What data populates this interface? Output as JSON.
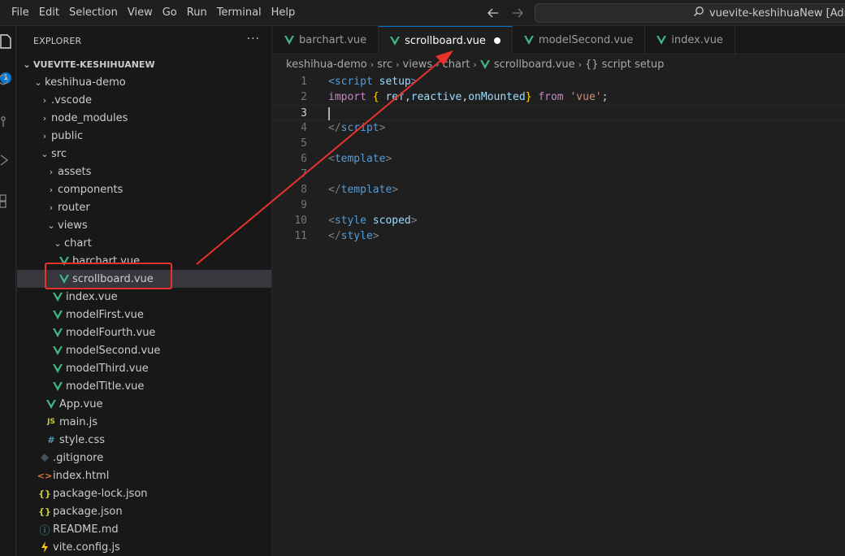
{
  "menu": {
    "items": [
      "File",
      "Edit",
      "Selection",
      "View",
      "Go",
      "Run",
      "Terminal",
      "Help"
    ]
  },
  "command_center": {
    "text": "vuevite-keshihuaNew [Administ",
    "icon": "search-icon"
  },
  "activity_bar": {
    "badge": "1",
    "icons": [
      "files-icon",
      "search-icon",
      "source-control-icon",
      "run-debug-icon",
      "extensions-icon"
    ]
  },
  "sidebar": {
    "title": "EXPLORER",
    "more": "···",
    "root": "VUEVITE-KESHIHUANEW",
    "items": [
      {
        "label": "keshihua-demo",
        "type": "folder-open"
      },
      {
        "label": ".vscode",
        "type": "folder"
      },
      {
        "label": "node_modules",
        "type": "folder"
      },
      {
        "label": "public",
        "type": "folder"
      },
      {
        "label": "src",
        "type": "folder-open"
      },
      {
        "label": "assets",
        "type": "folder"
      },
      {
        "label": "components",
        "type": "folder"
      },
      {
        "label": "router",
        "type": "folder"
      },
      {
        "label": "views",
        "type": "folder-open"
      },
      {
        "label": "chart",
        "type": "folder-open"
      },
      {
        "label": "barchart.vue",
        "type": "vue"
      },
      {
        "label": "scrollboard.vue",
        "type": "vue"
      },
      {
        "label": "index.vue",
        "type": "vue"
      },
      {
        "label": "modelFirst.vue",
        "type": "vue"
      },
      {
        "label": "modelFourth.vue",
        "type": "vue"
      },
      {
        "label": "modelSecond.vue",
        "type": "vue"
      },
      {
        "label": "modelThird.vue",
        "type": "vue"
      },
      {
        "label": "modelTitle.vue",
        "type": "vue"
      },
      {
        "label": "App.vue",
        "type": "vue"
      },
      {
        "label": "main.js",
        "type": "js",
        "icon_text": "JS"
      },
      {
        "label": "style.css",
        "type": "css",
        "icon_text": "#"
      },
      {
        "label": ".gitignore",
        "type": "git"
      },
      {
        "label": "index.html",
        "type": "html",
        "icon_text": "<>"
      },
      {
        "label": "package-lock.json",
        "type": "json",
        "icon_text": "{}"
      },
      {
        "label": "package.json",
        "type": "json",
        "icon_text": "{}"
      },
      {
        "label": "README.md",
        "type": "info",
        "icon_text": "ⓘ"
      },
      {
        "label": "vite.config.js",
        "type": "vite"
      }
    ]
  },
  "tabs": [
    {
      "label": "barchart.vue",
      "active": false
    },
    {
      "label": "scrollboard.vue",
      "active": true,
      "modified": true
    },
    {
      "label": "modelSecond.vue",
      "active": false
    },
    {
      "label": "index.vue",
      "active": false
    }
  ],
  "breadcrumb": [
    "keshihua-demo",
    "src",
    "views",
    "chart",
    "scrollboard.vue",
    "{} script setup"
  ],
  "editor": {
    "current_line": 3,
    "lines": [
      {
        "n": "1",
        "tokens": [
          [
            "tag",
            "<script"
          ],
          [
            "attr",
            " setup"
          ],
          [
            "tag",
            ">"
          ]
        ]
      },
      {
        "n": "2",
        "tokens": [
          [
            "kw",
            "import"
          ],
          [
            "punc",
            " "
          ],
          [
            "brace",
            "{"
          ],
          [
            "punc",
            " "
          ],
          [
            "var",
            "ref"
          ],
          [
            "punc",
            ","
          ],
          [
            "var",
            "reactive"
          ],
          [
            "punc",
            ","
          ],
          [
            "var",
            "onMounted"
          ],
          [
            "brace",
            "}"
          ],
          [
            "punc",
            " "
          ],
          [
            "kw",
            "from"
          ],
          [
            "punc",
            " "
          ],
          [
            "str",
            "'vue'"
          ],
          [
            "punc",
            ";"
          ]
        ]
      },
      {
        "n": "3",
        "tokens": []
      },
      {
        "n": "4",
        "tokens": [
          [
            "gray",
            "</"
          ],
          [
            "tag",
            "script"
          ],
          [
            "gray",
            ">"
          ]
        ]
      },
      {
        "n": "5",
        "tokens": []
      },
      {
        "n": "6",
        "tokens": [
          [
            "gray",
            "<"
          ],
          [
            "tag",
            "template"
          ],
          [
            "gray",
            ">"
          ]
        ]
      },
      {
        "n": "7",
        "tokens": []
      },
      {
        "n": "8",
        "tokens": [
          [
            "gray",
            "</"
          ],
          [
            "tag",
            "template"
          ],
          [
            "gray",
            ">"
          ]
        ]
      },
      {
        "n": "9",
        "tokens": []
      },
      {
        "n": "10",
        "tokens": [
          [
            "gray",
            "<"
          ],
          [
            "tag",
            "style"
          ],
          [
            "attr",
            " scoped"
          ],
          [
            "gray",
            ">"
          ]
        ]
      },
      {
        "n": "11",
        "tokens": [
          [
            "gray",
            "</"
          ],
          [
            "tag",
            "style"
          ],
          [
            "gray",
            ">"
          ]
        ]
      }
    ]
  },
  "colors": {
    "vue_green": "#41b883",
    "js_yellow": "#cbcb41",
    "css_blue": "#519aba",
    "html_orange": "#e37933",
    "json_yellow": "#cbcb41",
    "info_blue": "#519aba",
    "git_gray": "#41535b",
    "vite_yellow": "#ffc517",
    "annotation_red": "#e8322b",
    "accent": "#0078d4"
  }
}
